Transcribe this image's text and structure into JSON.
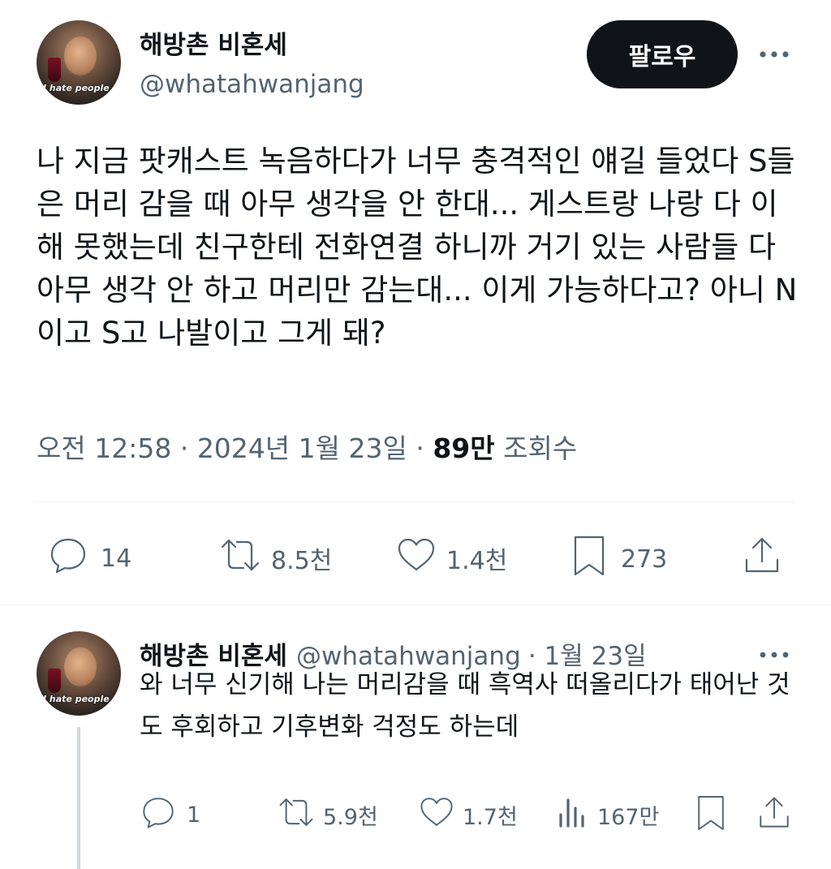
{
  "tweet": {
    "author_name": "해방촌 비혼세",
    "author_handle": "@whatahwanjang",
    "avatar_caption": "I hate people",
    "follow_label": "팔로우",
    "more_icon": "more-icon",
    "text": "나 지금 팟캐스트 녹음하다가 너무 충격적인 얘길 들었다 S들은 머리 감을 때 아무 생각을 안 한대... 게스트랑 나랑 다 이해 못했는데 친구한테 전화연결 하니까 거기 있는 사람들 다 아무 생각 안 하고 머리만 감는대... 이게 가능하다고? 아니 N이고 S고 나발이고 그게 돼?",
    "time": "오전 12:58",
    "separator": "·",
    "date": "2024년 1월 23일",
    "views_count": "89만",
    "views_label": "조회수",
    "actions": {
      "replies": "14",
      "retweets": "8.5천",
      "likes": "1.4천",
      "bookmarks": "273"
    }
  },
  "reply": {
    "author_name": "해방촌 비혼세",
    "author_handle": "@whatahwanjang",
    "date": "· 1월 23일",
    "text": "와 너무 신기해 나는 머리감을 때 흑역사 떠올리다가 태어난 것도 후회하고 기후변화 걱정도 하는데",
    "actions": {
      "replies": "1",
      "retweets": "5.9천",
      "likes": "1.7천",
      "views": "167만"
    }
  },
  "colors": {
    "text_primary": "#0f1419",
    "text_secondary": "#536471",
    "button_bg": "#0f1419",
    "divider": "#eff3f4",
    "thread_line": "#cfd9de"
  }
}
